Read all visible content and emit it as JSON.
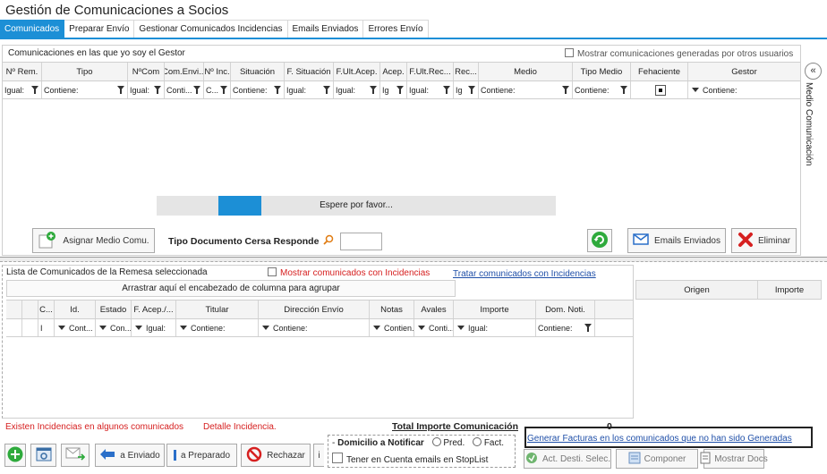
{
  "title": "Gestión de Comunicaciones a Socios",
  "tabs": [
    {
      "label": "Comunicados"
    },
    {
      "label": "Preparar Envío"
    },
    {
      "label": "Gestionar Comunicados Incidencias"
    },
    {
      "label": "Emails Enviados"
    },
    {
      "label": "Errores Envío"
    }
  ],
  "section1": {
    "title": "Comunicaciones en las que yo soy el Gestor",
    "show_others_label": "Mostrar comunicaciones generadas por otros usuarios",
    "columns": [
      "Nº Rem.",
      "Tipo",
      "NºCom",
      "Com.Envi...",
      "Nº Inc.",
      "Situación",
      "F. Situación",
      "F.Ult.Acep.",
      "Acep.",
      "F.Ult.Rec...",
      "Rec...",
      "Medio",
      "Tipo Medio",
      "Fehaciente",
      "Gestor"
    ],
    "filters": [
      "Igual:",
      "Contiene:",
      "Igual:",
      "Conti...",
      "C...",
      "Contiene:",
      "Igual:",
      "Igual:",
      "Ig",
      "Igual:",
      "Ig",
      "Contiene:",
      "Contiene:",
      "",
      "Contiene:"
    ],
    "progress_text": "Espere por favor...",
    "progress_value": 0.12,
    "assign_button": "Asignar Medio Comu.",
    "tipo_doc_label": "Tipo Documento Cersa Responde",
    "emails_button": "Emails Enviados",
    "delete_button": "Eliminar"
  },
  "side_panel": {
    "label": "Medio Comunicación",
    "collapse": "«"
  },
  "section2": {
    "title": "Lista de Comunicados de la Remesa seleccionada",
    "show_incidences_label": "Mostrar comunicados con Incidencias",
    "treat_link": "Tratar comunicados con Incidencias",
    "group_hint": "Arrastrar aquí el encabezado de columna para agrupar",
    "columns": [
      "",
      "",
      "C...",
      "Id.",
      "Estado",
      "F. Acep./...",
      "Titular",
      "Dirección Envío",
      "Notas",
      "Avales",
      "Importe",
      "Dom. Noti."
    ],
    "filters": [
      "",
      "",
      "I",
      "Cont...",
      "Con...",
      "Igual:",
      "Contiene:",
      "Contiene:",
      "Contien...",
      "Conti...",
      "Igual:",
      "Contiene:"
    ]
  },
  "right_table": {
    "columns": [
      "Origen",
      "Importe"
    ]
  },
  "footer": {
    "incidences_text": "Existen Incidencias en algunos comunicados",
    "detail_text": "Detalle Incidencia.",
    "total_label": "Total Importe Comunicación",
    "total_value": "0",
    "generate_link": "Generar Facturas en los comunicados que no han sido Generadas",
    "to_sent": "a Enviado",
    "to_prepared": "a Preparado",
    "reject": "Rechazar",
    "info_btn": "i",
    "domicilio_label": "Domicilio a Notificar",
    "pred": "Pred.",
    "fact": "Fact.",
    "stoplist": "Tener en Cuenta emails en StopList",
    "act_dest": "Act. Desti. Selec.",
    "componer": "Componer",
    "mostrar_docs": "Mostrar Docs"
  },
  "colors": {
    "accent": "#1c8fd6",
    "error": "#d62020",
    "link": "#1f4fa8",
    "add_green": "#2eaa3c"
  }
}
